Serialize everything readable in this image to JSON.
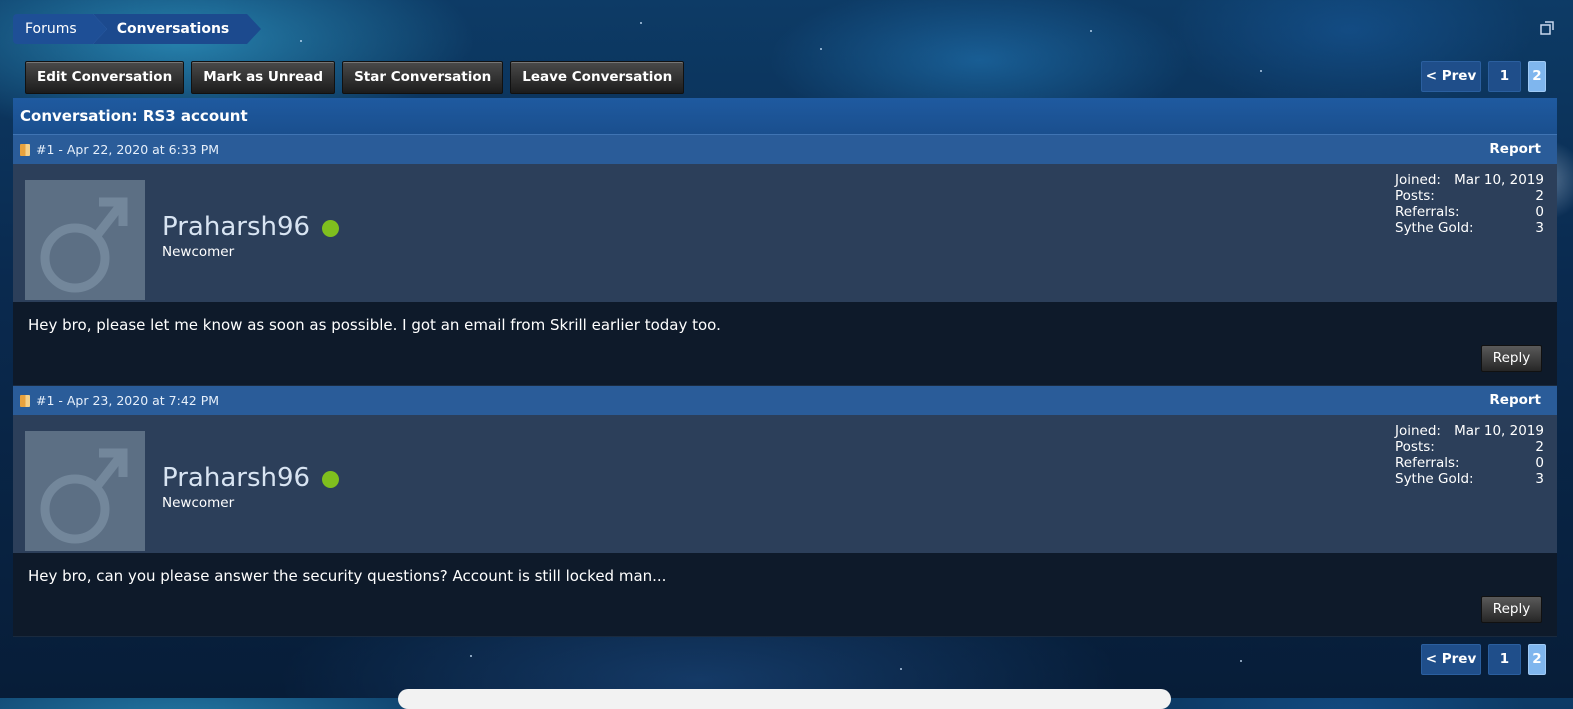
{
  "breadcrumb": {
    "items": [
      "Forums",
      "Conversations"
    ]
  },
  "actions": [
    "Edit Conversation",
    "Mark as Unread",
    "Star Conversation",
    "Leave Conversation"
  ],
  "pager": {
    "prev": "< Prev",
    "pages": [
      "1",
      "2"
    ],
    "current": "2"
  },
  "conversation": {
    "title": "Conversation: RS3 account"
  },
  "stat_labels": {
    "joined": "Joined:",
    "posts": "Posts:",
    "referrals": "Referrals:",
    "gold": "Sythe Gold:"
  },
  "posts": [
    {
      "meta": "#1 - Apr 22, 2020 at 6:33 PM",
      "report": "Report",
      "username": "Praharsh96",
      "user_title": "Newcomer",
      "joined": "Mar 10, 2019",
      "posts": "2",
      "referrals": "0",
      "gold": "3",
      "message": "Hey bro, please let me know as soon as possible. I got an email from Skrill earlier today too.",
      "reply": "Reply"
    },
    {
      "meta": "#1 - Apr 23, 2020 at 7:42 PM",
      "report": "Report",
      "username": "Praharsh96",
      "user_title": "Newcomer",
      "joined": "Mar 10, 2019",
      "posts": "2",
      "referrals": "0",
      "gold": "3",
      "message": "Hey bro, can you please answer the security questions? Account is still locked man...",
      "reply": "Reply"
    }
  ],
  "colors": {
    "online": "#7fbf1e",
    "header_blue": "#1f5aa0",
    "post_head": "#2a5c99"
  }
}
